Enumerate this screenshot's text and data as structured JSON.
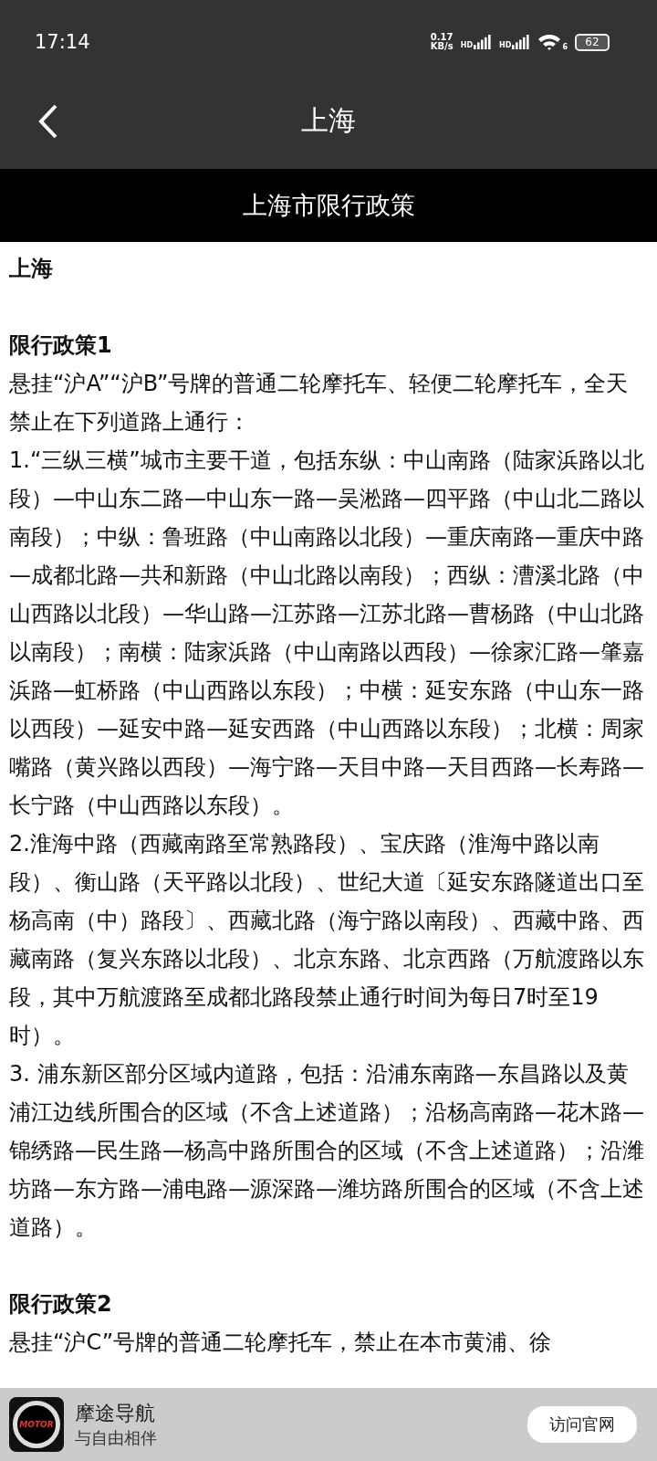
{
  "status_bar": {
    "time": "17:14",
    "speed_value": "0.17",
    "speed_unit": "KB/s",
    "signals": [
      {
        "label": "HD"
      },
      {
        "label": "HD"
      }
    ],
    "wifi_label": "6",
    "battery": "62"
  },
  "app_bar": {
    "title": "上海"
  },
  "section_header": {
    "title": "上海市限行政策"
  },
  "content": {
    "city": "上海",
    "policies": [
      {
        "title": "限行政策1",
        "paragraphs": [
          "悬挂“沪A”“沪B”号牌的普通二轮摩托车、轻便二轮摩托车，全天禁止在下列道路上通行：",
          "1.“三纵三横”城市主要干道，包括东纵：中山南路（陆家浜路以北段）—中山东二路—中山东一路—吴淞路—四平路（中山北二路以南段）；中纵：鲁班路（中山南路以北段）—重庆南路—重庆中路—成都北路—共和新路（中山北路以南段）；西纵：漕溪北路（中山西路以北段）—华山路—江苏路—江苏北路—曹杨路（中山北路以南段）；南横：陆家浜路（中山南路以西段）—徐家汇路—肇嘉浜路—虹桥路（中山西路以东段）；中横：延安东路（中山东一路以西段）—延安中路—延安西路（中山西路以东段）；北横：周家嘴路（黄兴路以西段）—海宁路—天目中路—天目西路—长寿路—长宁路（中山西路以东段）。",
          "2.淮海中路（西藏南路至常熟路段）、宝庆路（淮海中路以南段）、衡山路（天平路以北段）、世纪大道〔延安东路隧道出口至杨高南（中）路段〕、西藏北路（海宁路以南段）、西藏中路、西藏南路（复兴东路以北段）、北京东路、北京西路（万航渡路以东段，其中万航渡路至成都北路段禁止通行时间为每日7时至19时）。",
          "3. 浦东新区部分区域内道路，包括：沿浦东南路—东昌路以及黄浦江边线所围合的区域（不含上述道路）；沿杨高南路—花木路—锦绣路—民生路—杨高中路所围合的区域（不含上述道路）；沿潍坊路—东方路—浦电路—源深路—潍坊路所围合的区域（不含上述道路）。"
        ]
      },
      {
        "title": "限行政策2",
        "paragraphs": [
          "悬挂“沪C”号牌的普通二轮摩托车，禁止在本市黄浦、徐"
        ]
      }
    ]
  },
  "banner": {
    "logo_text": "MOTOR",
    "app_name": "摩途导航",
    "slogan": "与自由相伴",
    "button": "访问官网"
  }
}
